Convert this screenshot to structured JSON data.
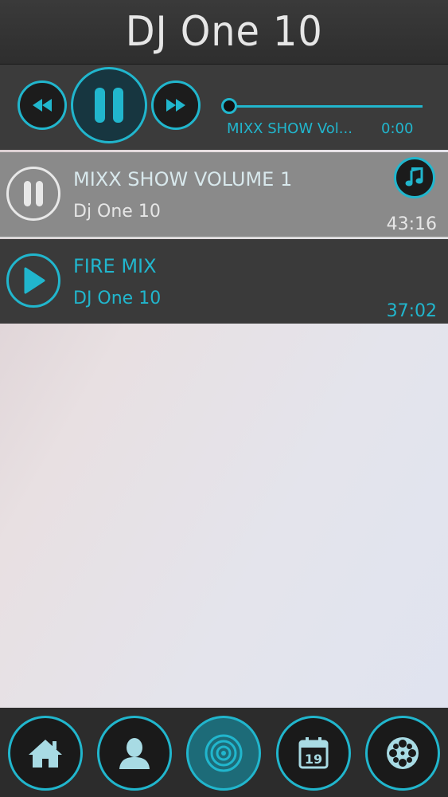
{
  "app": {
    "title": "DJ One 10"
  },
  "player": {
    "rewind_icon": "rewind-icon",
    "pause_icon": "pause-icon",
    "fast_forward_icon": "fast-forward-icon",
    "now_playing_title": "MIXX SHOW Vol...",
    "elapsed": "0:00",
    "progress": 0
  },
  "tracks": [
    {
      "title": "MIXX SHOW VOLUME 1",
      "artist": "Dj One 10",
      "duration": "43:16",
      "state": "playing",
      "badge_icon": "music-note-icon"
    },
    {
      "title": "FIRE MIX",
      "artist": "DJ One 10",
      "duration": "37:02",
      "state": "paused"
    }
  ],
  "tabs": [
    {
      "name": "home",
      "icon": "home-icon"
    },
    {
      "name": "profile",
      "icon": "person-icon"
    },
    {
      "name": "music",
      "icon": "speaker-icon",
      "active": true
    },
    {
      "name": "events",
      "icon": "calendar-icon",
      "calendar_day": "19"
    },
    {
      "name": "videos",
      "icon": "film-reel-icon"
    }
  ],
  "colors": {
    "accent": "#21b6cd",
    "bar": "#3b3b3b",
    "selected_row": "#8a8a8a"
  }
}
